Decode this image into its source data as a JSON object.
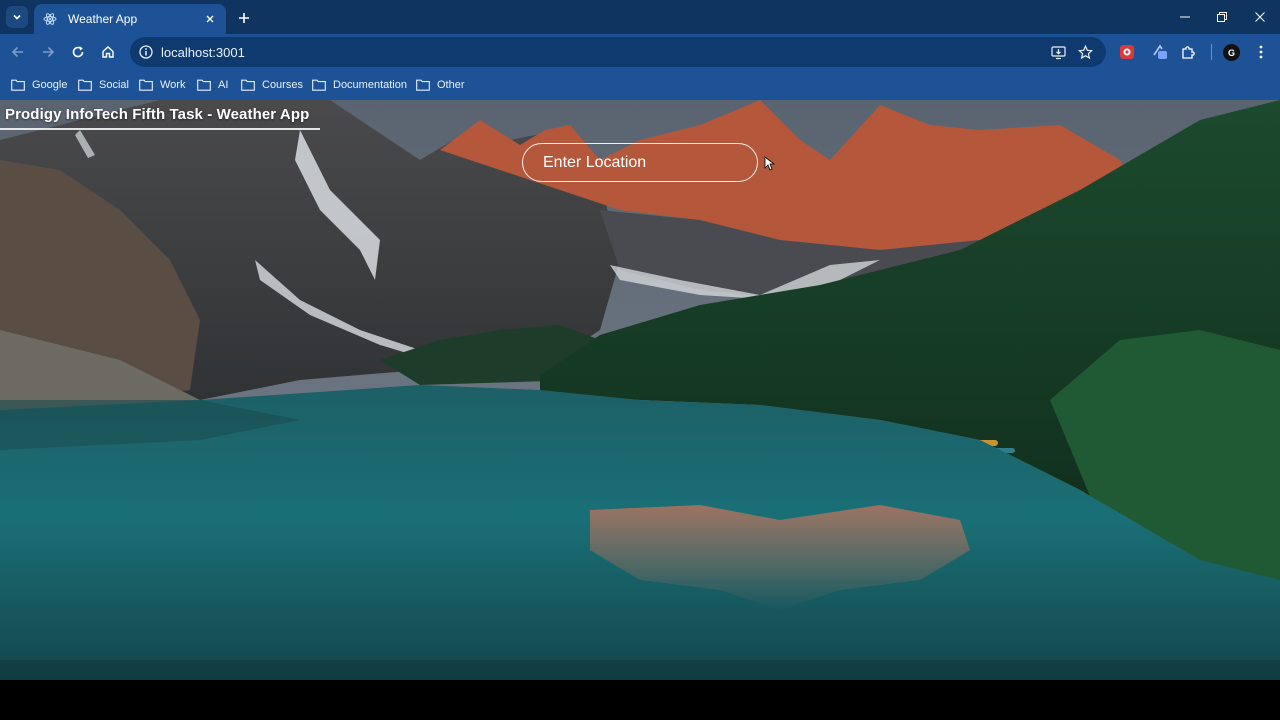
{
  "browser": {
    "tab": {
      "title": "Weather App",
      "favicon": "react-icon"
    },
    "address": {
      "url": "localhost:3001"
    },
    "bookmarks": [
      "Google",
      "Social",
      "Work",
      "AI",
      "Courses",
      "Documentation",
      "Other"
    ],
    "profile_initial": "G",
    "colors": {
      "frame": "#0f3460",
      "toolbar": "#1d5396",
      "omnibox": "#0f3a70"
    }
  },
  "page": {
    "title": "Prodigy InfoTech Fifth Task - Weather App",
    "search": {
      "placeholder": "Enter Location",
      "value": ""
    },
    "background": "mountain-lake-scene"
  }
}
